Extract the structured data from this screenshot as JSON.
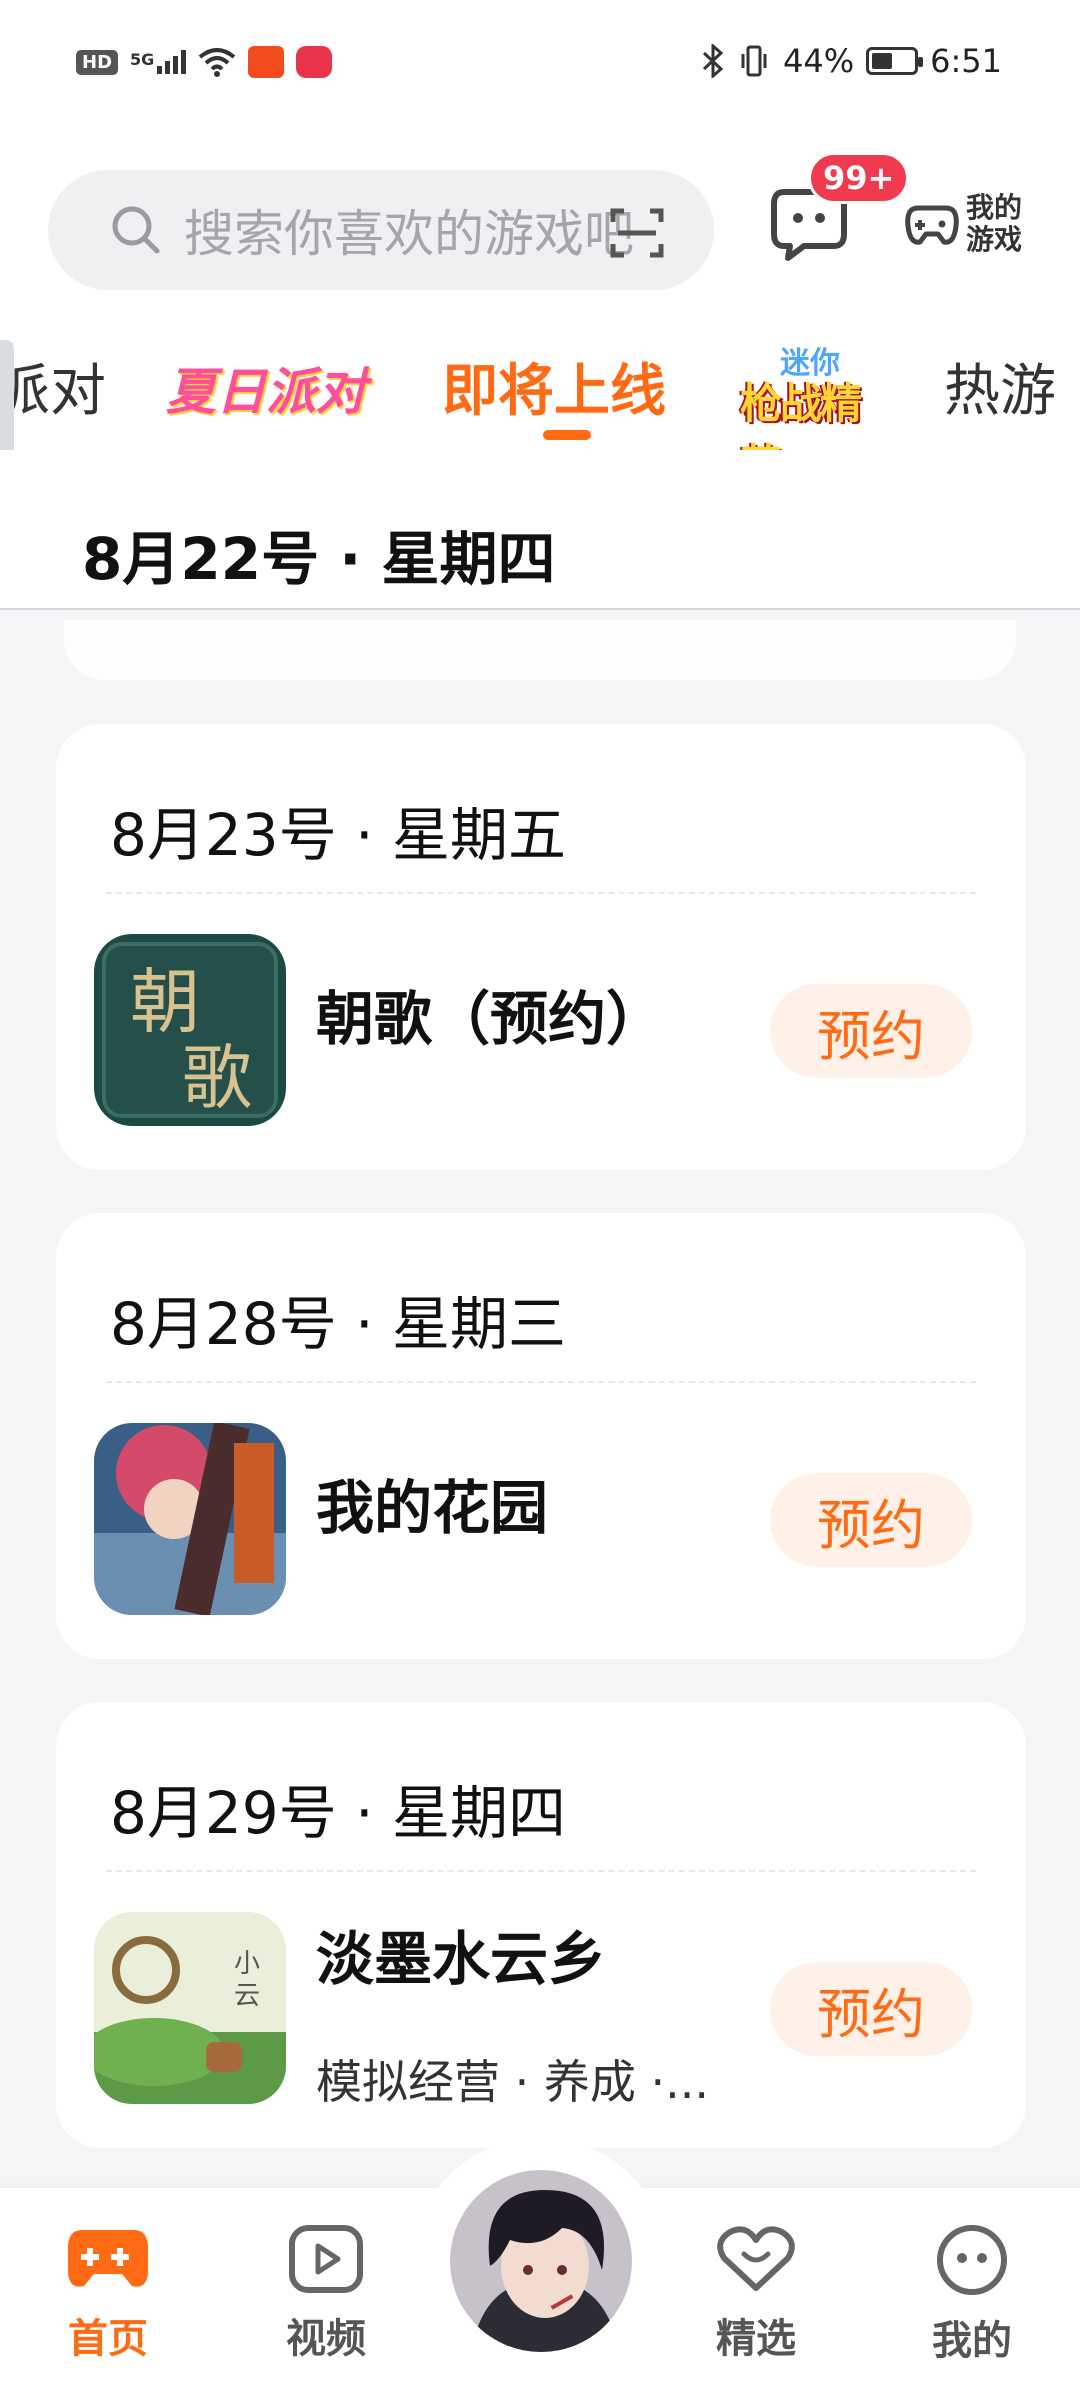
{
  "status_bar": {
    "hd": "HD",
    "signal": "5G",
    "battery": "44%",
    "battery_level": 0.44,
    "time": "6:51"
  },
  "header": {
    "search_placeholder": "搜索你喜欢的游戏吧",
    "messages_badge": "99+",
    "my_games_label": "我的游戏"
  },
  "tabs": [
    {
      "label": "派对"
    },
    {
      "label": "夏日派对",
      "type": "logo"
    },
    {
      "label": "即将上线",
      "active": true
    },
    {
      "label": "迷你枪战精英",
      "type": "logo"
    },
    {
      "label": "热游"
    }
  ],
  "sticky_date": "8月22号 · 星期四",
  "cards": [
    {
      "date": "8月23号 · 星期五",
      "name": "朝歌（预约）",
      "tags": "",
      "button": "预约",
      "icon": "chaoge-icon"
    },
    {
      "date": "8月28号 · 星期三",
      "name": "我的花园",
      "tags": "",
      "button": "预约",
      "icon": "garden-icon"
    },
    {
      "date": "8月29号 · 星期四",
      "name": "淡墨水云乡",
      "tags": "模拟经营 · 养成 ·...",
      "button": "预约",
      "icon": "danmo-icon"
    }
  ],
  "bottom_nav": [
    {
      "label": "首页",
      "icon": "gamepad-icon",
      "active": true
    },
    {
      "label": "视频",
      "icon": "video-icon"
    },
    {
      "label": "",
      "icon": "avatar"
    },
    {
      "label": "精选",
      "icon": "heart-icon"
    },
    {
      "label": "我的",
      "icon": "face-icon"
    }
  ],
  "colors": {
    "accent": "#ff6a13",
    "badge": "#f23a4f",
    "button_bg": "#fff0e8"
  }
}
